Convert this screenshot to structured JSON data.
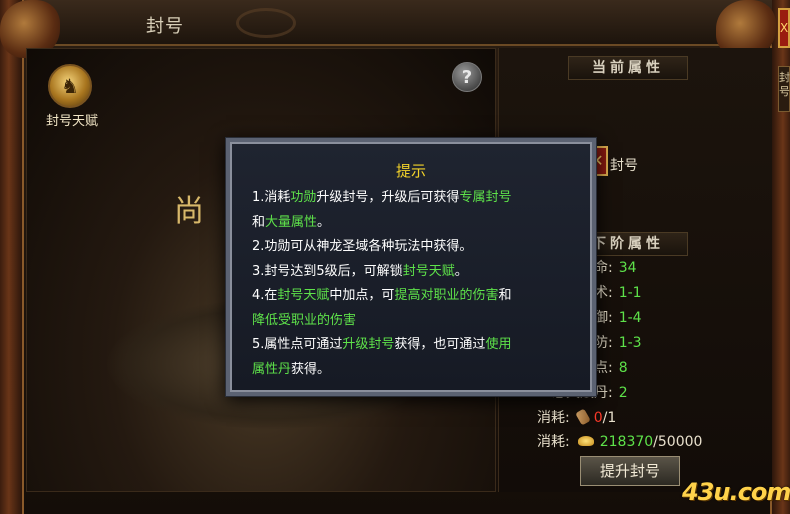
{
  "window": {
    "title": "封号"
  },
  "side_tab": {
    "label": "封号"
  },
  "close_glyph": "X",
  "left": {
    "emblem_label": "封号天赋",
    "help_glyph": "?",
    "bg_glyph": "尚"
  },
  "right": {
    "current_header": "当前属性",
    "next_header": "下阶属性",
    "x_button": "✕",
    "x_label": "封号",
    "stats": [
      {
        "label": "命:",
        "value": "34"
      },
      {
        "label": "术:",
        "value": "1-1"
      },
      {
        "label": "御:",
        "value": "1-4"
      },
      {
        "label": "防:",
        "value": "1-3"
      },
      {
        "label": "赋点:",
        "value": "8"
      },
      {
        "label": "总天赋丹:",
        "value": "2"
      }
    ],
    "costs": [
      {
        "label": "消耗:",
        "have": "0",
        "sep": "/",
        "need": "1"
      },
      {
        "label": "消耗:",
        "have": "218370",
        "sep": "/",
        "need": "50000"
      }
    ],
    "upgrade_button": "提升封号"
  },
  "tip": {
    "title": "提示",
    "lines": {
      "l1a": "1.消耗",
      "l1b": "功勋",
      "l1c": "升级封号，升级后可获得",
      "l1d": "专属封号",
      "l1e": "和",
      "l1f": "大量属性",
      "l1g": "。",
      "l2": "2.功勋可从神龙圣域各种玩法中获得。",
      "l3a": "3.封号达到5级后，可解锁",
      "l3b": "封号天赋",
      "l3c": "。",
      "l4a": "4.在",
      "l4b": "封号天赋",
      "l4c": "中加点，可",
      "l4d": "提高对职业的伤害",
      "l4e": "和",
      "l4f": "降低受职业的伤害",
      "l5a": "5.属性点可通过",
      "l5b": "升级封号",
      "l5c": "获得，也可通过",
      "l5d": "使用",
      "l5e": "属性丹",
      "l5f": "获得。"
    }
  },
  "watermark": "43u.com",
  "colors": {
    "highlight_green": "#5ee24a",
    "tip_title_yellow": "#f2d22a",
    "cost_red": "#ff3a2a"
  }
}
